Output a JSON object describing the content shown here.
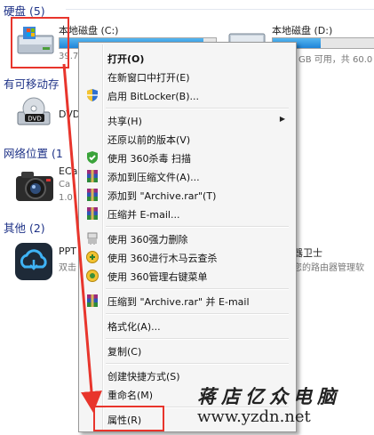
{
  "groups": {
    "hdd": "硬盘 (5)",
    "removable": "有可移动存",
    "network": "网络位置 (1",
    "other": "其他 (2)"
  },
  "drives": {
    "c": {
      "name": "本地磁盘 (C:)",
      "free_text": "39.7",
      "used_fraction": 0.92
    },
    "d": {
      "name": "本地磁盘 (D:)",
      "free_text": "GB 可用，共 60.0",
      "used_fraction": 0.45
    }
  },
  "devices": {
    "dvd": {
      "name": "DVD"
    },
    "ec": {
      "name": "ECa",
      "line2": "Ca",
      "line3": "1.0"
    },
    "pp": {
      "name": "PPT",
      "line2": "双击"
    },
    "router": {
      "name": "器卫士",
      "line2": "您的路由器管理软"
    }
  },
  "menu": {
    "items": [
      {
        "label": "打开(O)",
        "icon": "none"
      },
      {
        "label": "在新窗口中打开(E)",
        "icon": "none"
      },
      {
        "label": "启用 BitLocker(B)...",
        "icon": "shield-icon"
      },
      {
        "label": "共享(H)",
        "icon": "none",
        "submenu": true
      },
      {
        "label": "还原以前的版本(V)",
        "icon": "none"
      },
      {
        "label": "使用 360杀毒 扫描",
        "icon": "360-antivirus-icon"
      },
      {
        "label": "添加到压缩文件(A)...",
        "icon": "winrar-icon"
      },
      {
        "label": "添加到 \"Archive.rar\"(T)",
        "icon": "winrar-icon"
      },
      {
        "label": "压缩并 E-mail...",
        "icon": "winrar-icon"
      },
      {
        "label": "使用 360强力删除",
        "icon": "360-shred-icon"
      },
      {
        "label": "使用 360进行木马云查杀",
        "icon": "360-trojan-icon"
      },
      {
        "label": "使用 360管理右键菜单",
        "icon": "360-manage-icon"
      },
      {
        "label": "压缩到 \"Archive.rar\" 并 E-mail",
        "icon": "winrar-icon"
      },
      {
        "label": "格式化(A)...",
        "icon": "none"
      },
      {
        "label": "复制(C)",
        "icon": "none"
      },
      {
        "label": "创建快捷方式(S)",
        "icon": "none"
      },
      {
        "label": "重命名(M)",
        "icon": "none"
      },
      {
        "label": "属性(R)",
        "icon": "none"
      }
    ],
    "submenu_arrow": "▶"
  },
  "watermark": {
    "line1": "蒋店亿众电脑",
    "line2": "www.yzdn.net"
  },
  "colors": {
    "annotation_red": "#e8352c",
    "group_text": "#1e3287"
  }
}
